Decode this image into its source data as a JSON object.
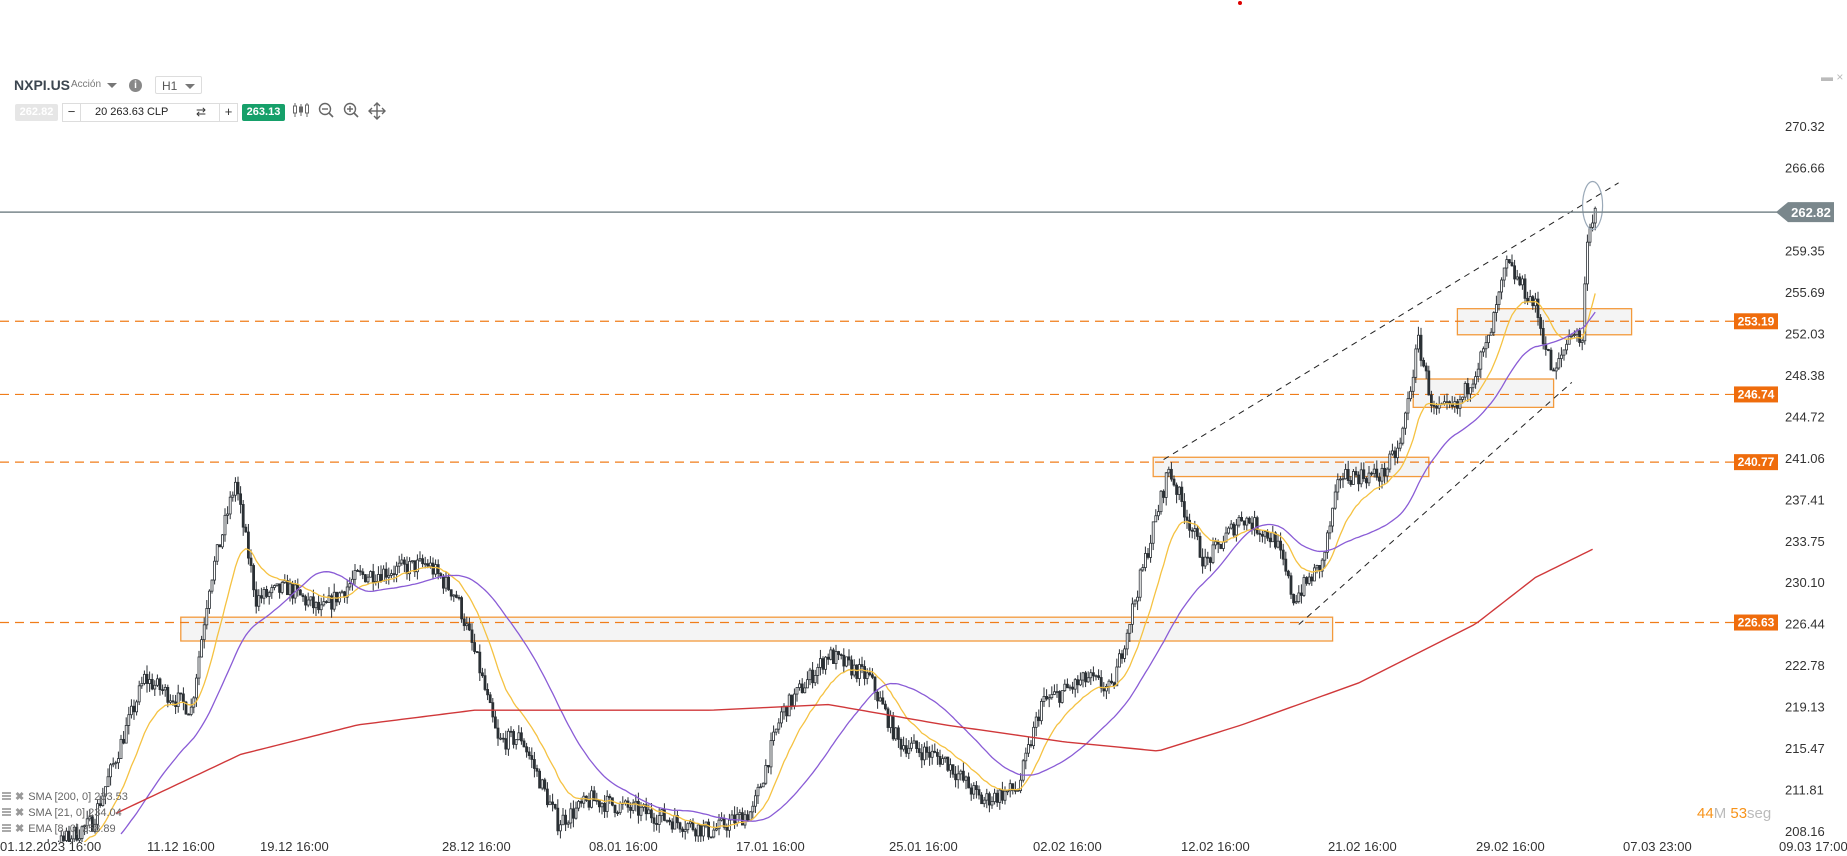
{
  "header": {
    "symbol": "NXPI.US",
    "instrument_type": "Acción",
    "info_icon": "info-icon",
    "timeframe": "H1"
  },
  "trade_bar": {
    "bid": "262.82",
    "amount": "20 263.63 CLP",
    "minus": "−",
    "plus": "+",
    "swap_icon": "⇄",
    "ask": "263.13",
    "tools": [
      "candles-icon",
      "zoom-out-icon",
      "zoom-in-icon",
      "move-icon"
    ]
  },
  "window": {
    "minimize": "▬",
    "close": "×"
  },
  "legend": [
    {
      "label": "SMA [200, 0] 233.53",
      "color": "#d0383a"
    },
    {
      "label": "SMA [21, 0] 234.04",
      "color": "#8a5cd6"
    },
    {
      "label": "EMA [8, 0] 258.89",
      "color": "#f5c242"
    }
  ],
  "countdown": {
    "minutes": "44",
    "m_unit": "M",
    "seconds": "53",
    "s_unit": "seg"
  },
  "chart_data": {
    "type": "candlestick",
    "symbol": "NXPI.US",
    "timeframe": "H1",
    "ylim": [
      208.16,
      270.32
    ],
    "y_ticks": [
      "270.32",
      "266.66",
      "259.35",
      "255.69",
      "252.03",
      "248.38",
      "244.72",
      "241.06",
      "237.41",
      "233.75",
      "230.10",
      "226.44",
      "222.78",
      "219.13",
      "215.47",
      "211.81",
      "208.16"
    ],
    "x_ticks": [
      "01.12.2023 16:00",
      "11.12 16:00",
      "19.12 16:00",
      "28.12 16:00",
      "08.01 16:00",
      "17.01 16:00",
      "25.01 16:00",
      "02.02 16:00",
      "12.02 16:00",
      "21.02 16:00",
      "29.02 16:00",
      "07.03 23:00",
      "09.03 17:00"
    ],
    "current_price": {
      "value": 262.82,
      "label": "262.82",
      "color": "#7a878c"
    },
    "levels": [
      {
        "value": 253.19,
        "label": "253.19"
      },
      {
        "value": 246.74,
        "label": "246.74"
      },
      {
        "value": 240.77,
        "label": "240.77"
      },
      {
        "value": 226.63,
        "label": "226.63"
      }
    ],
    "level_color": "#f07d1a",
    "price_path_bar_index": [
      [
        0,
        204
      ],
      [
        34,
        209
      ],
      [
        54,
        221.7
      ],
      [
        72,
        219
      ],
      [
        79,
        230
      ],
      [
        89,
        239
      ],
      [
        97,
        228.7
      ],
      [
        109,
        229.7
      ],
      [
        122,
        227.6
      ],
      [
        136,
        230.7
      ],
      [
        163,
        231.8
      ],
      [
        174,
        229
      ],
      [
        183,
        222.5
      ],
      [
        190,
        216.1
      ],
      [
        199,
        216.5
      ],
      [
        213,
        209
      ],
      [
        226,
        211
      ],
      [
        245,
        210
      ],
      [
        272,
        208.2
      ],
      [
        288,
        210
      ],
      [
        299,
        218.6
      ],
      [
        317,
        223.8
      ],
      [
        333,
        221.7
      ],
      [
        344,
        216.1
      ],
      [
        362,
        214.5
      ],
      [
        376,
        210.9
      ],
      [
        390,
        212
      ],
      [
        399,
        219.5
      ],
      [
        417,
        221.7
      ],
      [
        426,
        220.6
      ],
      [
        435,
        228.7
      ],
      [
        448,
        240.2
      ],
      [
        455,
        236
      ],
      [
        462,
        231.8
      ],
      [
        476,
        236
      ],
      [
        489,
        233.9
      ],
      [
        496,
        228.7
      ],
      [
        507,
        231.8
      ],
      [
        514,
        239.6
      ],
      [
        530,
        239.6
      ],
      [
        537,
        242.2
      ],
      [
        544,
        251.4
      ],
      [
        550,
        245.2
      ],
      [
        559,
        245.5
      ],
      [
        571,
        251.4
      ],
      [
        578,
        258.2
      ],
      [
        589,
        254.5
      ],
      [
        596,
        248.3
      ],
      [
        603,
        252.5
      ],
      [
        607,
        251.4
      ],
      [
        609,
        260.9
      ],
      [
        612,
        263.1
      ]
    ],
    "sma200_path": [
      [
        43,
        209.8
      ],
      [
        91,
        215.0
      ],
      [
        136,
        217.6
      ],
      [
        181,
        218.9
      ],
      [
        272,
        218.9
      ],
      [
        317,
        219.4
      ],
      [
        362,
        217.6
      ],
      [
        408,
        216.1
      ],
      [
        444,
        215.3
      ],
      [
        476,
        217.6
      ],
      [
        521,
        221.3
      ],
      [
        566,
        226.5
      ],
      [
        589,
        230.6
      ],
      [
        612,
        233.2
      ]
    ],
    "zones": [
      {
        "from_bar": 68,
        "to_bar": 511,
        "top": 227.1,
        "bottom": 225.0
      },
      {
        "from_bar": 442,
        "to_bar": 548,
        "top": 241.2,
        "bottom": 239.5
      },
      {
        "from_bar": 542,
        "to_bar": 596,
        "top": 248.1,
        "bottom": 245.6
      },
      {
        "from_bar": 559,
        "to_bar": 626,
        "top": 254.3,
        "bottom": 252.0
      }
    ],
    "trendlines": [
      {
        "from": [
          446,
          241.0
        ],
        "to": [
          621,
          265.4
        ]
      },
      {
        "from": [
          498,
          226.45
        ],
        "to": [
          603,
          247.8
        ]
      }
    ],
    "marker_circle": {
      "bar": 611,
      "price": 263.4
    }
  }
}
